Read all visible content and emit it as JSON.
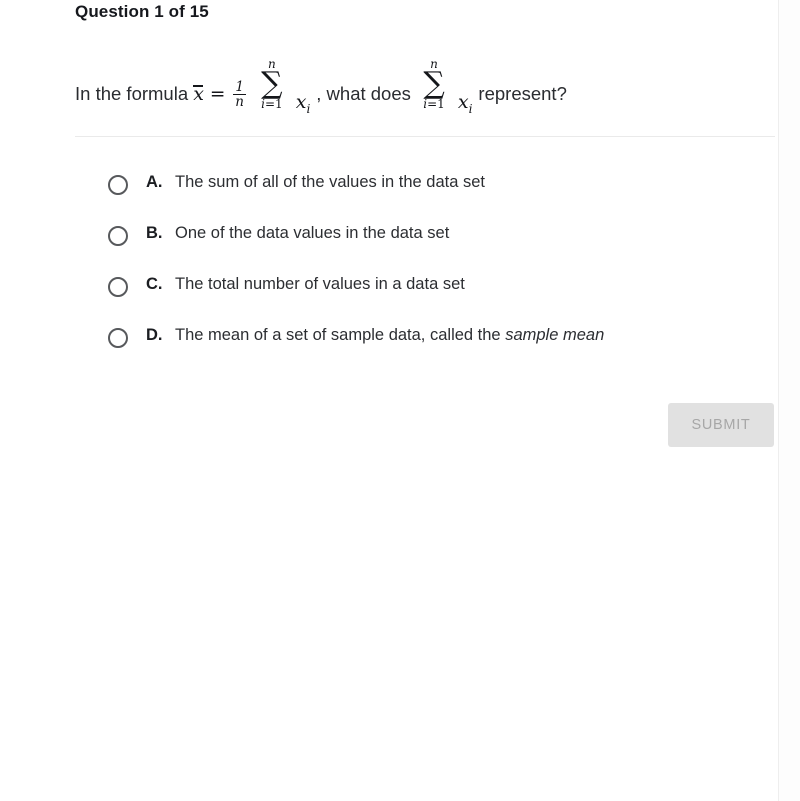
{
  "header": {
    "counter_text": "Question 1 of 15"
  },
  "question": {
    "lead_text": "In the formula",
    "formula": {
      "mean_symbol": "x",
      "equals": "=",
      "fraction_numerator": "1",
      "fraction_denominator": "n",
      "sum_upper_limit": "n",
      "sum_glyph": "∑",
      "sum_lower_limit_index": "i",
      "sum_lower_limit_equals": "=",
      "sum_lower_limit_value": "1",
      "term_base": "x",
      "term_subscript": "i"
    },
    "middle_text": ", what does",
    "trailing_text": "represent?"
  },
  "options": [
    {
      "letter": "A.",
      "text": "The sum of all of the values in the data set",
      "text_italic_tail": ""
    },
    {
      "letter": "B.",
      "text": "One of the data values in the data set",
      "text_italic_tail": ""
    },
    {
      "letter": "C.",
      "text": "The total number of values in a data set",
      "text_italic_tail": ""
    },
    {
      "letter": "D.",
      "text": "The mean of a set of sample data, called the ",
      "text_italic_tail": "sample mean"
    }
  ],
  "submit": {
    "label": "SUBMIT"
  },
  "colors": {
    "text_primary": "#2a2c30",
    "heading": "#16181d",
    "divider": "#eaeaea",
    "radio_border": "#57595c",
    "submit_background": "#e1e1e1",
    "submit_text": "#a7a7a7",
    "page_background": "#ffffff"
  }
}
